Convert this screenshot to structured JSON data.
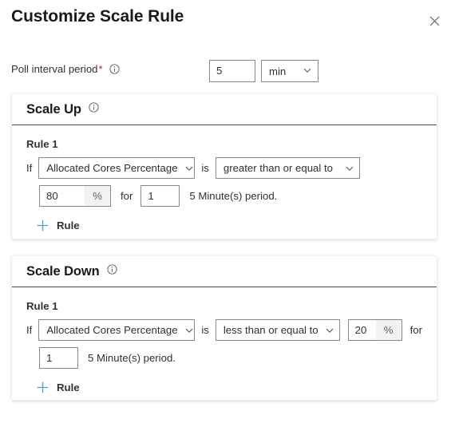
{
  "dialog": {
    "title": "Customize Scale Rule",
    "close_label": "close-icon"
  },
  "poll_interval": {
    "label": "Poll interval period",
    "required_marker": "*",
    "info_tooltip": "info-icon",
    "value": "5",
    "unit": "min"
  },
  "scale_up": {
    "heading": "Scale Up",
    "info_tooltip": "info-icon",
    "rule_label": "Rule 1",
    "if_text": "If",
    "metric": "Allocated Cores Percentage",
    "is_text": "is",
    "operator": "greater than or equal to",
    "threshold": "80",
    "threshold_suffix": "%",
    "for_text": "for",
    "duration": "1",
    "period_text": "5 Minute(s) period.",
    "add_rule_label": "Rule",
    "add_rule_icon": "plus-icon"
  },
  "scale_down": {
    "heading": "Scale Down",
    "info_tooltip": "info-icon",
    "rule_label": "Rule 1",
    "if_text": "If",
    "metric": "Allocated Cores Percentage",
    "is_text": "is",
    "operator": "less than or equal to",
    "threshold": "20",
    "threshold_suffix": "%",
    "for_text": "for",
    "duration": "1",
    "period_text": "5 Minute(s) period.",
    "add_rule_label": "Rule",
    "add_rule_icon": "plus-icon"
  },
  "colors": {
    "accent": "#0078d4",
    "add_link": "#5b9bd5",
    "required": "#a4262c",
    "text": "#323130",
    "border": "#8a8886",
    "divider": "#484644"
  }
}
